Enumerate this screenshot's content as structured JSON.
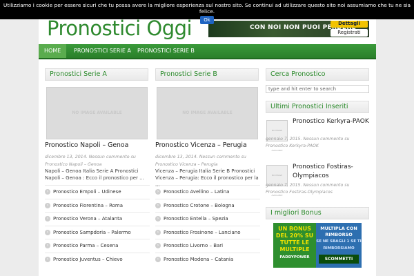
{
  "cookie": {
    "text": "Utilizziamo i cookie per essere sicuri che tu possa avere la migliore esperienza sul nostro sito. Se continui ad utilizzare questo sito noi assumiamo che tu ne sia felice.",
    "ok_label": "Ok"
  },
  "header": {
    "logo": "Pronostici Oggi",
    "banner_text": "CON NOI NON PUOI PERDERE",
    "banner_btn1": "Dettagli",
    "banner_btn2": "Registrati"
  },
  "nav": {
    "items": [
      {
        "label": "HOME"
      },
      {
        "label": "PRONOSTICI SERIE A"
      },
      {
        "label": "PRONOSTICI SERIE B"
      }
    ]
  },
  "colA": {
    "heading": "Pronostici Serie A",
    "noimage": "NO IMAGE AVAILABLE",
    "title": "Pronostico Napoli – Genoa",
    "meta": "dicembre 13, 2014. Nessun commento su Pronostico Napoli – Genoa",
    "excerpt": "Napoli – Genoa Italia Serie A Pronostici Napoli – Genoa : Ecco il pronostico per ...",
    "links": [
      "Pronostico Empoli – Udinese",
      "Pronostico Fiorentina – Roma",
      "Pronostico Verona – Atalanta",
      "Pronostico Sampdoria – Palermo",
      "Pronostico Parma – Cesena",
      "Pronostico Juventus – Chievo"
    ]
  },
  "colB": {
    "heading": "Pronostici Serie B",
    "noimage": "NO IMAGE AVAILABLE",
    "title": "Pronostico Vicenza – Perugia",
    "meta": "dicembre 13, 2014. Nessun commento su Pronostico Vicenza – Perugia",
    "excerpt": "Vicenza – Perugia Italia Serie B Pronostici Vicenza – Perugia: Ecco il pronostico per la ...",
    "links": [
      "Pronostico Avellino – Latina",
      "Pronostico Crotone – Bologna",
      "Pronostico Entella – Spezia",
      "Pronostico Frosinone – Lanciano",
      "Pronostico Livorno – Bari",
      "Pronostico Modena – Catania"
    ]
  },
  "sidebar": {
    "search_heading": "Cerca Pronostico",
    "search_placeholder": "type and hit enter to search",
    "latest_heading": "Ultimi Pronostici Inseriti",
    "latest": [
      {
        "thumb": "NO IMAGE AVAILABLE",
        "title": "Pronostico Kerkyra-PAOK",
        "meta": "gennaio 7, 2015. Nessun commento su Pronostico Kerkyra-PAOK"
      },
      {
        "thumb": "NO IMAGE AVAILABLE",
        "title": "Pronostico Fostiras-Olympiacos",
        "meta": "gennaio 7, 2015. Nessun commento su Pronostico Fostiras-Olympiacos"
      }
    ],
    "bonus_heading": "I migliori Bonus",
    "bonus1": "UN BONUS DEL 20% SU TUTTE LE MULTIPLE",
    "bonus1_brand": "PADDYPOWER",
    "bonus2": "MULTIPLA CON RIMBORSO",
    "bonus2_sub": "SE NE SBAGLI 1 SE TI RIMBORSIAMO",
    "bonus2_cta": "SCOMMETTI"
  }
}
